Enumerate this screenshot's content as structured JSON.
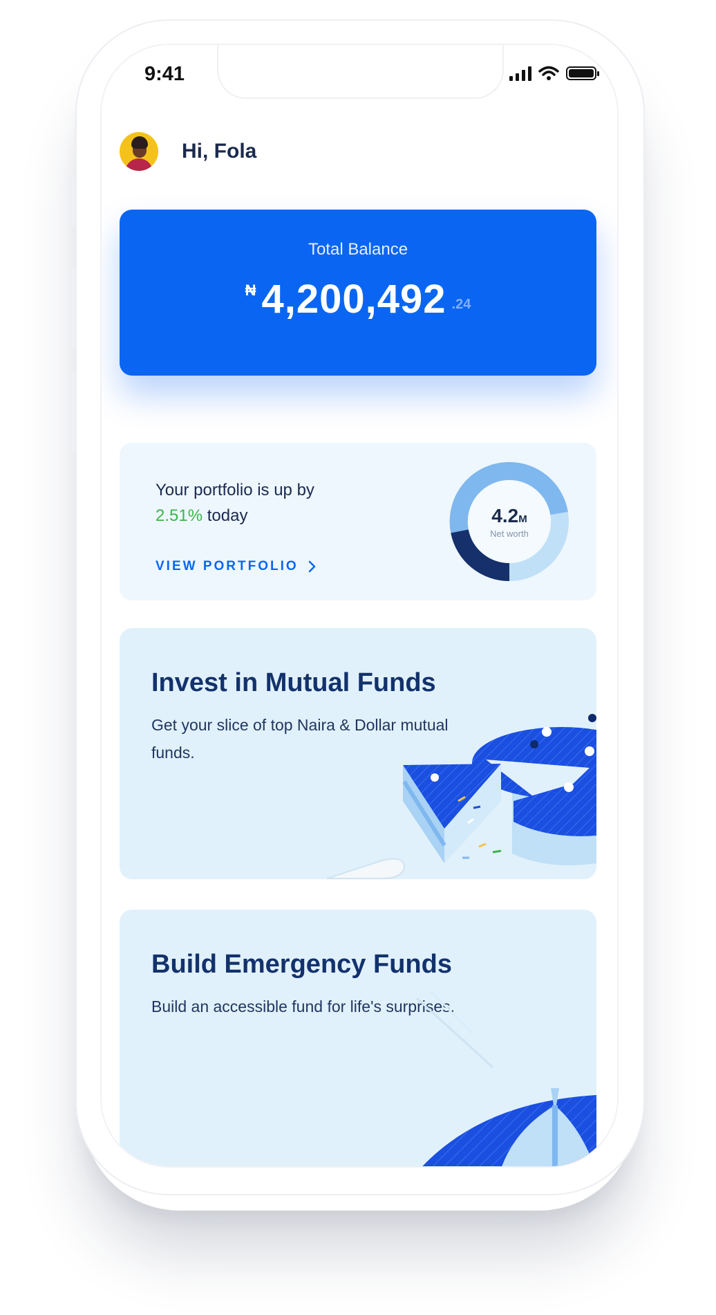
{
  "status_bar": {
    "time": "9:41"
  },
  "header": {
    "greeting": "Hi, Fola"
  },
  "balance": {
    "label": "Total Balance",
    "currency_symbol": "₦",
    "amount": "4,200,492",
    "cents": ".24"
  },
  "portfolio": {
    "text_prefix": "Your portfolio is up by",
    "percent": "2.51%",
    "text_suffix": "today",
    "link_label": "VIEW PORTFOLIO",
    "net_worth_value": "4.2",
    "net_worth_unit": "M",
    "net_worth_label": "Net worth"
  },
  "promos": [
    {
      "title": "Invest in Mutual Funds",
      "description": "Get your slice of top Naira & Dollar mutual funds."
    },
    {
      "title": "Build Emergency Funds",
      "description": "Build an accessible fund for life's surprises."
    }
  ],
  "colors": {
    "accent": "#0a66f2",
    "positive": "#3cb44a",
    "navy": "#13326c",
    "card_light": "#eef7fd",
    "promo_bg": "#e1f1fb"
  }
}
